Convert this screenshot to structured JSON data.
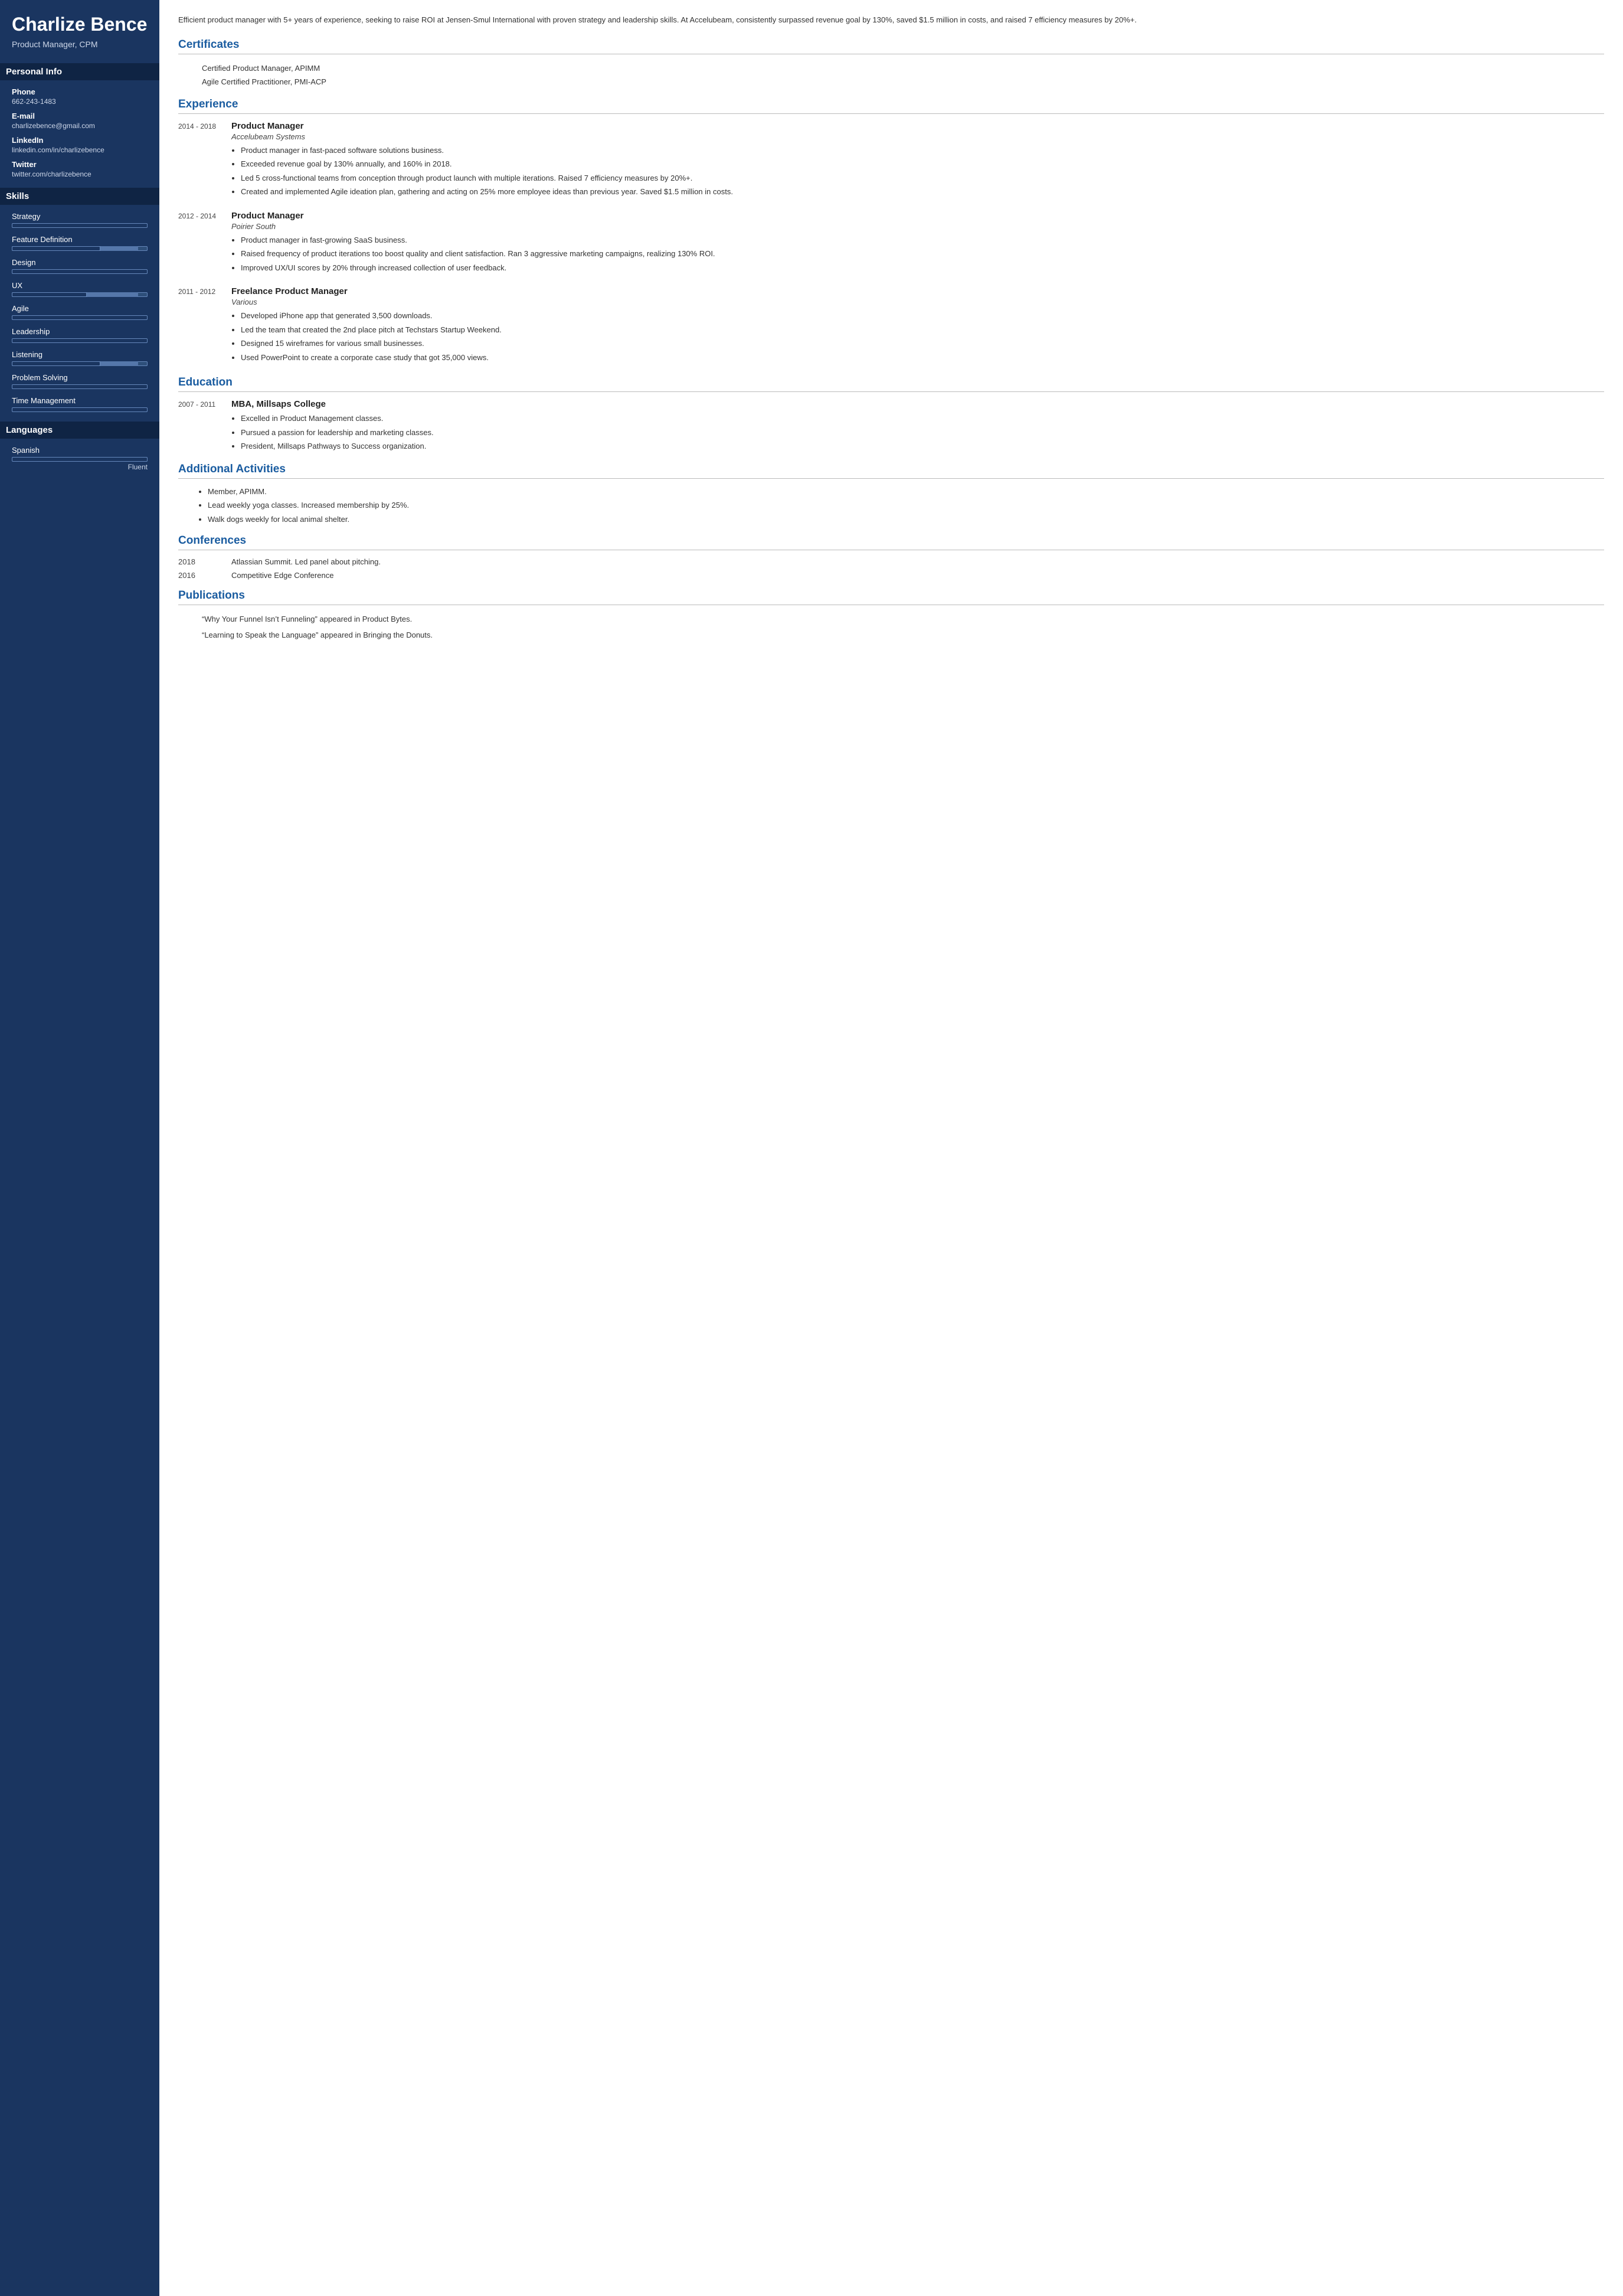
{
  "sidebar": {
    "name": "Charlize Bence",
    "title": "Product Manager, CPM",
    "sections": {
      "personal_info": {
        "label": "Personal Info",
        "fields": [
          {
            "label": "Phone",
            "value": "662-243-1483"
          },
          {
            "label": "E-mail",
            "value": "charlizebence@gmail.com"
          },
          {
            "label": "LinkedIn",
            "value": "linkedin.com/in/charlizebence"
          },
          {
            "label": "Twitter",
            "value": "twitter.com/charlizebence"
          }
        ]
      },
      "skills": {
        "label": "Skills",
        "items": [
          {
            "name": "Strategy",
            "fill_pct": 100,
            "extra_pct": 0
          },
          {
            "name": "Feature Definition",
            "fill_pct": 65,
            "extra_pct": 30
          },
          {
            "name": "Design",
            "fill_pct": 100,
            "extra_pct": 0
          },
          {
            "name": "UX",
            "fill_pct": 55,
            "extra_pct": 40
          },
          {
            "name": "Agile",
            "fill_pct": 100,
            "extra_pct": 0
          },
          {
            "name": "Leadership",
            "fill_pct": 100,
            "extra_pct": 0
          },
          {
            "name": "Listening",
            "fill_pct": 65,
            "extra_pct": 30
          },
          {
            "name": "Problem Solving",
            "fill_pct": 100,
            "extra_pct": 0
          },
          {
            "name": "Time Management",
            "fill_pct": 100,
            "extra_pct": 0
          }
        ]
      },
      "languages": {
        "label": "Languages",
        "items": [
          {
            "name": "Spanish",
            "fill_pct": 100,
            "level": "Fluent"
          }
        ]
      }
    }
  },
  "main": {
    "summary": "Efficient product manager with 5+ years of experience, seeking to raise ROI at Jensen-Smul International with proven strategy and leadership skills. At Accelubeam, consistently surpassed revenue goal by 130%, saved $1.5 million in costs, and raised 7 efficiency measures by 20%+.",
    "certificates": {
      "section_title": "Certificates",
      "items": [
        "Certified Product Manager, APIMM",
        "Agile Certified Practitioner, PMI-ACP"
      ]
    },
    "experience": {
      "section_title": "Experience",
      "items": [
        {
          "dates": "2014 - 2018",
          "role": "Product Manager",
          "company": "Accelubeam Systems",
          "bullets": [
            "Product manager in fast-paced software solutions business.",
            "Exceeded revenue goal by 130% annually, and 160% in 2018.",
            "Led 5 cross-functional teams from conception through product launch with multiple iterations. Raised 7 efficiency measures by 20%+.",
            "Created and implemented Agile ideation plan, gathering and acting on 25% more employee ideas than previous year. Saved $1.5 million in costs."
          ]
        },
        {
          "dates": "2012 - 2014",
          "role": "Product Manager",
          "company": "Poirier South",
          "bullets": [
            "Product manager in fast-growing SaaS business.",
            "Raised frequency of product iterations too boost quality and client satisfaction. Ran 3 aggressive marketing campaigns, realizing 130% ROI.",
            "Improved UX/UI scores by 20% through increased collection of user feedback."
          ]
        },
        {
          "dates": "2011 - 2012",
          "role": "Freelance Product Manager",
          "company": "Various",
          "bullets": [
            "Developed iPhone app that generated 3,500 downloads.",
            "Led the team that created the 2nd place pitch at Techstars Startup Weekend.",
            "Designed 15 wireframes for various small businesses.",
            "Used PowerPoint to create a corporate case study that got 35,000 views."
          ]
        }
      ]
    },
    "education": {
      "section_title": "Education",
      "items": [
        {
          "dates": "2007 - 2011",
          "degree": "MBA, Millsaps College",
          "bullets": [
            "Excelled in Product Management classes.",
            "Pursued a passion for leadership and marketing classes.",
            "President, Millsaps Pathways to Success organization."
          ]
        }
      ]
    },
    "additional_activities": {
      "section_title": "Additional Activities",
      "bullets": [
        "Member, APIMM.",
        "Lead weekly yoga classes. Increased membership by 25%.",
        "Walk dogs weekly for local animal shelter."
      ]
    },
    "conferences": {
      "section_title": "Conferences",
      "items": [
        {
          "year": "2018",
          "name": "Atlassian Summit. Led panel about pitching."
        },
        {
          "year": "2016",
          "name": "Competitive Edge Conference"
        }
      ]
    },
    "publications": {
      "section_title": "Publications",
      "items": [
        "“Why Your Funnel Isn’t Funneling” appeared in Product Bytes.",
        "“Learning to Speak the Language” appeared in Bringing the Donuts."
      ]
    }
  }
}
